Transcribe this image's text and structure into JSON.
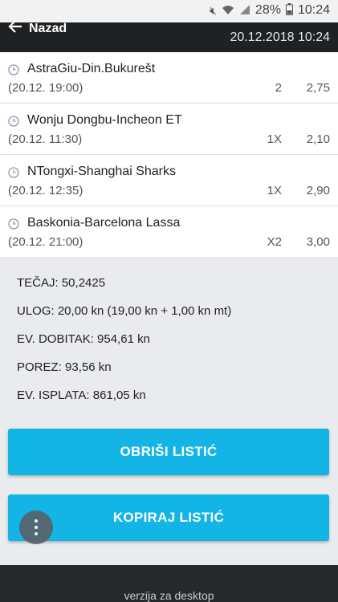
{
  "statusbar": {
    "battery_percent": "28%",
    "time": "10:24"
  },
  "appbar": {
    "back_label": "Nazad",
    "datetime": "20.12.2018 10:24"
  },
  "matches": [
    {
      "teams": "AstraGiu-Din.Bukurešt",
      "time": "(20.12. 19:00)",
      "tip": "2",
      "odd": "2,75"
    },
    {
      "teams": "Wonju Dongbu-Incheon ET",
      "time": "(20.12. 11:30)",
      "tip": "1X",
      "odd": "2,10"
    },
    {
      "teams": "NTongxi-Shanghai Sharks",
      "time": "(20.12. 12:35)",
      "tip": "1X",
      "odd": "2,90"
    },
    {
      "teams": "Baskonia-Barcelona Lassa",
      "time": "(20.12. 21:00)",
      "tip": "X2",
      "odd": "3,00"
    }
  ],
  "summary": {
    "tecaj": "TEČAJ: 50,2425",
    "ulog": "ULOG: 20,00 kn (19,00 kn + 1,00 kn mt)",
    "dobitak": "EV. DOBITAK: 954,61 kn",
    "porez": "POREZ: 93,56 kn",
    "isplata": "EV. ISPLATA: 861,05 kn"
  },
  "buttons": {
    "delete_label": "OBRIŠI LISTIĆ",
    "copy_label": "KOPIRAJ LISTIĆ"
  },
  "footer": {
    "desktop_link": "verzija za desktop"
  },
  "colors": {
    "accent": "#12b5e6",
    "appbar": "#1f2225"
  }
}
